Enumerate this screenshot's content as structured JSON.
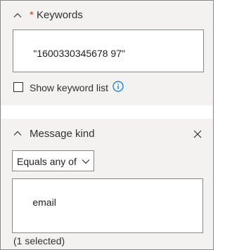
{
  "keywords": {
    "title": "Keywords",
    "required_mark": "*",
    "value": "\"1600330345678 97\"",
    "show_list_label": "Show keyword list"
  },
  "message_kind": {
    "title": "Message kind",
    "operator": "Equals any of",
    "value": "email",
    "selected_count": "(1 selected)"
  },
  "colors": {
    "required": "#d83b01",
    "info": "#0078d4",
    "panel_bg": "#f3f2f1",
    "border": "#8a8886"
  }
}
